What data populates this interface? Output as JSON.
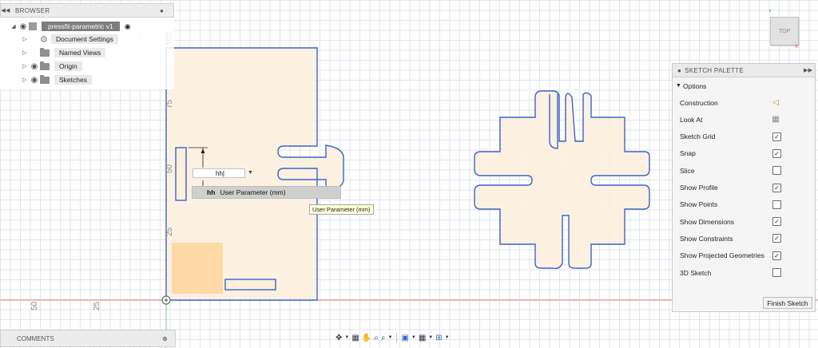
{
  "browser": {
    "title": "BROWSER",
    "items": [
      {
        "label": "pressfit-parametric v1"
      },
      {
        "label": "Document Settings"
      },
      {
        "label": "Named Views"
      },
      {
        "label": "Origin"
      },
      {
        "label": "Sketches"
      }
    ]
  },
  "comments": {
    "title": "COMMENTS"
  },
  "palette": {
    "title": "SKETCH PALETTE",
    "section": "Options",
    "options": [
      {
        "label": "Construction",
        "icon": "construction-icon"
      },
      {
        "label": "Look At",
        "icon": "calendar-icon"
      },
      {
        "label": "Sketch Grid",
        "checked": true
      },
      {
        "label": "Snap",
        "checked": true
      },
      {
        "label": "Slice",
        "checked": false
      },
      {
        "label": "Show Profile",
        "checked": true
      },
      {
        "label": "Show Points",
        "checked": false
      },
      {
        "label": "Show Dimensions",
        "checked": true
      },
      {
        "label": "Show Constraints",
        "checked": true
      },
      {
        "label": "Show Projected Geometries",
        "checked": true
      },
      {
        "label": "3D Sketch",
        "checked": false
      }
    ],
    "finish_label": "Finish Sketch"
  },
  "viewcube": {
    "label": "TOP"
  },
  "dimension_input": {
    "value": "hh"
  },
  "autocomplete": {
    "prefix": "hh",
    "text": "User Parameter (mm)"
  },
  "tooltip": {
    "text": "User Parameter (mm)"
  },
  "ruler": {
    "vertical": [
      "100",
      "75",
      "50",
      "25"
    ],
    "horizontal": [
      "50",
      "25"
    ]
  },
  "colors": {
    "sketch_line": "#3a64c8",
    "profile_fill": "#fdeedd",
    "selected_fill": "#fdd9a6",
    "grid": "#e1e6ec",
    "x_axis": "#e57b7b",
    "y_axis": "#7cc47c"
  }
}
